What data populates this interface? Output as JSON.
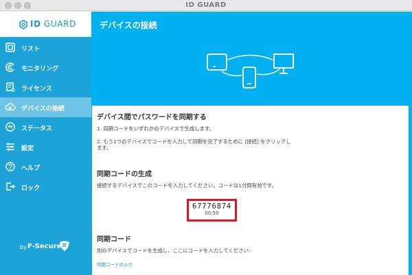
{
  "window": {
    "title": "ID GUARD"
  },
  "logo": {
    "part1": "ID",
    "part2": " GUARD"
  },
  "sidebar": {
    "items": [
      {
        "label": "リスト",
        "icon": "list-icon",
        "active": false
      },
      {
        "label": "モニタリング",
        "icon": "monitoring-icon",
        "active": false
      },
      {
        "label": "ライセンス",
        "icon": "license-icon",
        "active": false
      },
      {
        "label": "デバイスの接続",
        "icon": "cloud-sync-icon",
        "active": true
      },
      {
        "label": "ステータス",
        "icon": "status-icon",
        "active": false
      },
      {
        "label": "設定",
        "icon": "settings-sliders-icon",
        "active": false
      },
      {
        "label": "ヘルプ",
        "icon": "help-icon",
        "active": false
      },
      {
        "label": "ロック",
        "icon": "lock-exit-icon",
        "active": false
      }
    ],
    "footer": {
      "by": "by",
      "brand": "F-Secure"
    }
  },
  "main": {
    "title": "デバイスの接続",
    "sync": {
      "heading": "デバイス間でパスワードを同期する",
      "step1": "1. 同期コードをいずれかのデバイスで生成します。",
      "step2_line1": "2. もう1つのデバイスでコードを入力して同期を完了するために [接続] をクリックし",
      "step2_line2": "ます。"
    },
    "generate": {
      "heading": "同期コードの生成",
      "description": "接続するデバイスでこのコードを入力してください。コードは1分間有効です。",
      "code": "67776874",
      "timer": "00:50"
    },
    "enter": {
      "heading": "同期コード",
      "description": "別のデバイスでコードを生成し、ここにコードを入力してください:",
      "link": "同期コードの入力"
    }
  },
  "colors": {
    "sidebar": "#1da3d8",
    "header": "#00b0f0",
    "active_item": "#6fc4e6",
    "highlight": "#e0141b"
  }
}
